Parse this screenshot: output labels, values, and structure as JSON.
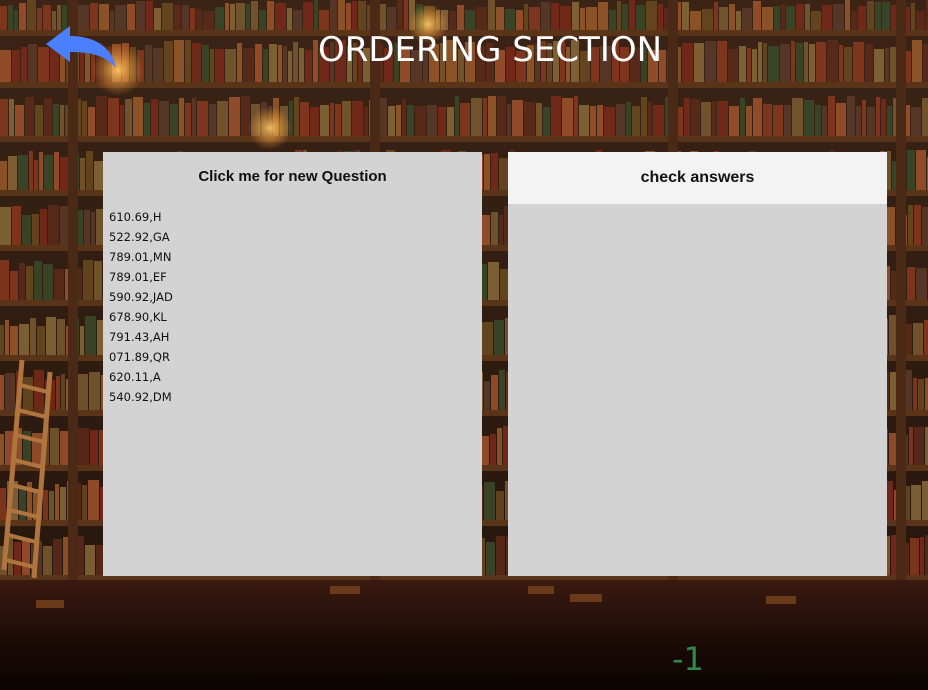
{
  "header": {
    "title": "ORDERING SECTION",
    "back_icon": "back-arrow-icon",
    "back_color": "#4a7fff"
  },
  "left_panel": {
    "button_label": "Click me for new Question",
    "items": [
      "610.69,H",
      "522.92,GA",
      "789.01,MN",
      "789.01,EF",
      "590.92,JAD",
      "678.90,KL",
      "791.43,AH",
      "071.89,QR",
      "620.11,A",
      "540.92,DM"
    ]
  },
  "right_panel": {
    "button_label": "check answers"
  },
  "score": {
    "value": "-1",
    "color": "#2f8a4a"
  }
}
